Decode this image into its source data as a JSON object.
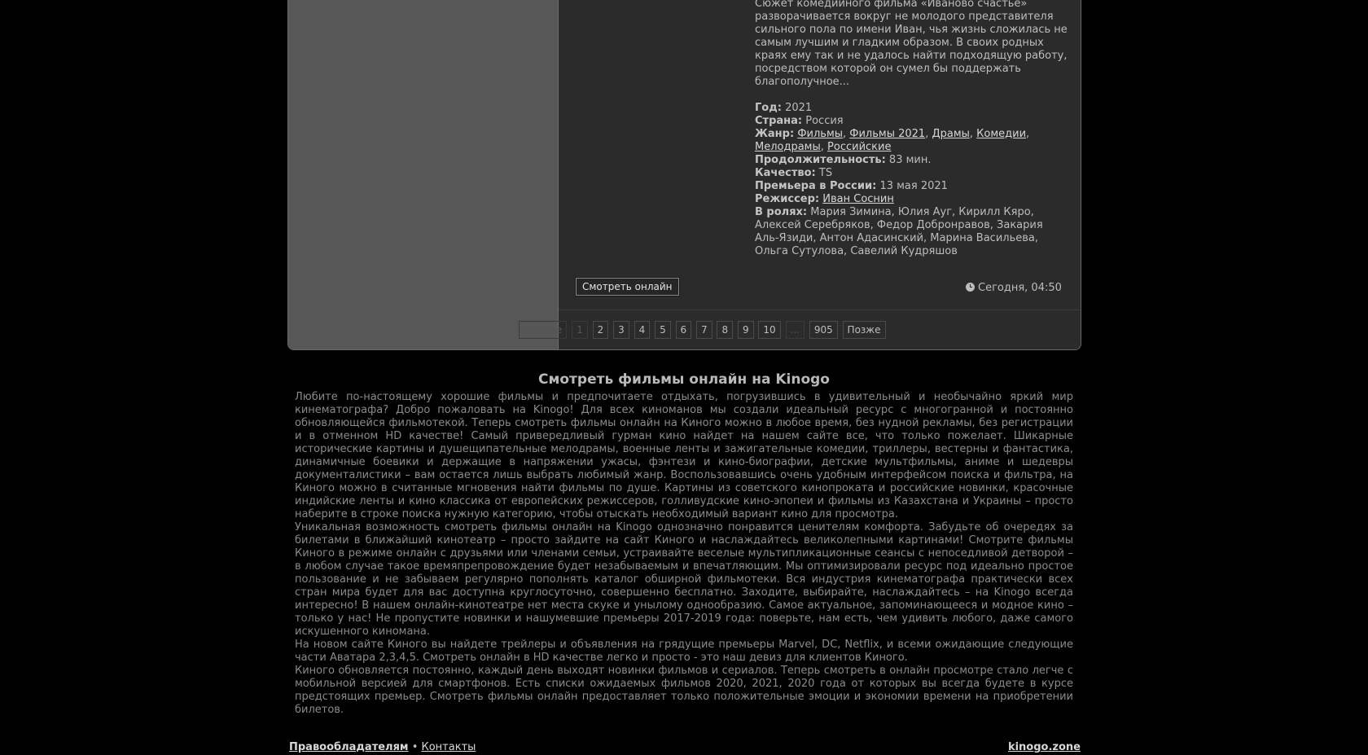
{
  "movie": {
    "description": "Сюжет комедийного фильма «Иваново счастье» разворачивается вокруг не молодого представителя сильного пола по имени Иван, чья жизнь сложилась не самым лучшим и гладким образом. В своих родных краях ему так и не удалось найти подходящую работу, посредством которой он сумел бы поддержать благополучное...",
    "year_label": "Год:",
    "year": "2021",
    "country_label": "Страна:",
    "country": "Россия",
    "genre_label": "Жанр:",
    "genres": [
      "Фильмы",
      "Фильмы 2021",
      "Драмы",
      "Комедии",
      "Мелодрамы",
      "Российские"
    ],
    "duration_label": "Продолжительность:",
    "duration": "83 мин.",
    "quality_label": "Качество:",
    "quality": "TS",
    "premiere_label": "Премьера в России:",
    "premiere": "13 мая 2021",
    "director_label": "Режиссер:",
    "director": "Иван Соснин",
    "cast_label": "В ролях:",
    "cast": "Мария Зимина, Юлия Ауг, Кирилл Кяро, Алексей Серебряков, Федор Добронравов, Закария Аль-Язиди, Антон Адасинский, Марина Васильева, Ольга Сутулова, Савелий Кудряшов",
    "watch_button": "Смотреть онлайн",
    "date": "Сегодня, 04:50",
    "clock_icon": "clock-icon"
  },
  "pagination": {
    "prev": "Раньше",
    "pages": [
      "1",
      "2",
      "3",
      "4",
      "5",
      "6",
      "7",
      "8",
      "9",
      "10"
    ],
    "ellipsis": "...",
    "last": "905",
    "next": "Позже"
  },
  "seo": {
    "title": "Смотреть фильмы онлайн на Kinogo",
    "paragraphs": [
      "Любите по-настоящему хорошие фильмы и предпочитаете отдыхать, погрузившись в удивительный и необычайно яркий мир кинематографа? Добро пожаловать на Kinogo! Для всех киноманов мы создали идеальный ресурс с многогранной и постоянно обновляющейся фильмотекой. Теперь смотреть фильмы онлайн на Киного можно в любое время, без нудной рекламы, без регистрации и в отменном HD качестве! Самый привередливый гурман кино найдет на нашем сайте все, что только пожелает. Шикарные исторические картины и душещипательные мелодрамы, военные ленты и зажигательные комедии, триллеры, вестерны и фантастика, динамичные боевики и держащие в напряжении ужасы, фэнтези и кино-биографии, детские мультфильмы, аниме и шедевры документалистики – вам остается лишь выбрать любимый жанр. Воспользовавшись очень удобным интерфейсом поиска и фильтра, на Киного можно в считанные мгновения найти фильмы по душе. Картины из советского кинопроката и российские новинки, красочные индийские ленты и кино классика от европейских режиссеров, голливудские кино-эпопеи и фильмы из Казахстана и Украины – просто наберите в строке поиска нужную категорию, чтобы отыскать необходимый вариант кино для просмотра.",
      "Уникальная возможность смотреть фильмы онлайн на Kinogo однозначно понравится ценителям комфорта. Забудьте об очередях за билетами в ближайший кинотеатр – просто зайдите на сайт Киного и наслаждайтесь великолепными картинами! Смотрите фильмы Киного в режиме онлайн с друзьями или членами семьи, устраивайте веселые мультипликационные сеансы с непоседливой детворой – в любом случае такое времяпрепровождение будет незабываемым и впечатляющим. Мы оптимизировали ресурс под идеально простое пользование и не забываем регулярно пополнять каталог обширной фильмотеки. Вся индустрия кинематографа практически всех стран мира будет для вас доступна круглосуточно, совершенно бесплатно. Заходите, выбирайте, наслаждайтесь – на Kinogo всегда интересно! В нашем онлайн-кинотеатре нет места скуке и унылому однообразию. Самое актуальное, запоминающееся и модное кино – только у нас! Не пропустите новинки и нашумевшие премьеры 2017-2019 года: поверьте, нам есть, чем удивить любого, даже самого искушенного киномана.",
      "На новом сайте Киного вы найдете трейлеры и объявления на грядущие премьеры Marvel, DC, Netflix, и всеми ожидающие следующие части Аватара 2,3,4,5. Смотреть онлайн в HD качестве легко и просто - это наш девиз для клиентов Киного.",
      "Киного обновляется постоянно, каждый день выходят новинки фильмов и сериалов. Теперь смотреть в онлайн просмотре стало легче с мобильной версией для смартфонов. Есть списки ожидаемых фильмов 2020, 2021, 2020 года от которых вы всегда будете в курсе предстоящих премьер. Смотреть фильмы онлайн предоставляет только положительные эмоции и экономии времени на приобретении билетов."
    ]
  },
  "footer": {
    "copyright_link": "Правообладателям",
    "separator": "•",
    "contacts_link": "Контакты",
    "site": "kinogo.zone"
  }
}
